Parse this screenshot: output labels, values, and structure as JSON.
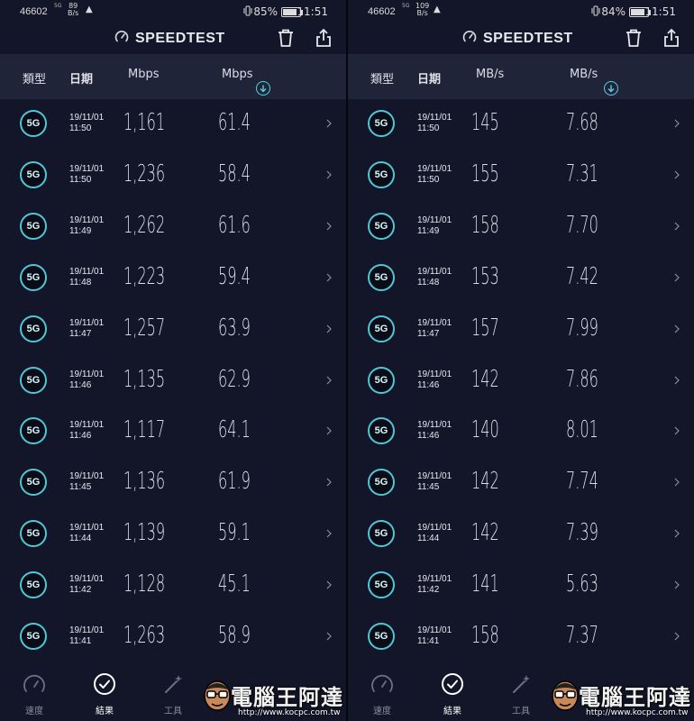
{
  "colors": {
    "background": "#131628",
    "header_bg": "#202439",
    "badge_ring": "#50c6d6",
    "download_accent": "#59cfe2",
    "upload_accent": "#c38de6"
  },
  "watermark": {
    "text": "電腦王阿達",
    "url": "http://www.kocpc.com.tw"
  },
  "screens": [
    {
      "status": {
        "carrier": "46602",
        "network": "5G",
        "net_speed_value": "89",
        "net_speed_unit": "B/s",
        "battery": "85%",
        "battery_level": 0.85,
        "time": "11:51"
      },
      "app_title": "SPEEDTEST",
      "headers": {
        "type": "類型",
        "date": "日期",
        "download_unit": "Mbps",
        "upload_unit": "Mbps"
      },
      "rows": [
        {
          "badge": "5G",
          "date": "19/11/01",
          "time": "11:50",
          "download": "1,161",
          "upload": "61.4"
        },
        {
          "badge": "5G",
          "date": "19/11/01",
          "time": "11:50",
          "download": "1,236",
          "upload": "58.4"
        },
        {
          "badge": "5G",
          "date": "19/11/01",
          "time": "11:49",
          "download": "1,262",
          "upload": "61.6"
        },
        {
          "badge": "5G",
          "date": "19/11/01",
          "time": "11:48",
          "download": "1,223",
          "upload": "59.4"
        },
        {
          "badge": "5G",
          "date": "19/11/01",
          "time": "11:47",
          "download": "1,257",
          "upload": "63.9"
        },
        {
          "badge": "5G",
          "date": "19/11/01",
          "time": "11:46",
          "download": "1,135",
          "upload": "62.9"
        },
        {
          "badge": "5G",
          "date": "19/11/01",
          "time": "11:46",
          "download": "1,117",
          "upload": "64.1"
        },
        {
          "badge": "5G",
          "date": "19/11/01",
          "time": "11:45",
          "download": "1,136",
          "upload": "61.9"
        },
        {
          "badge": "5G",
          "date": "19/11/01",
          "time": "11:44",
          "download": "1,139",
          "upload": "59.1"
        },
        {
          "badge": "5G",
          "date": "19/11/01",
          "time": "11:42",
          "download": "1,128",
          "upload": "45.1"
        },
        {
          "badge": "5G",
          "date": "19/11/01",
          "time": "11:41",
          "download": "1,263",
          "upload": "58.9"
        }
      ],
      "tabs": {
        "speed": "速度",
        "results": "結果",
        "tools": "工具"
      }
    },
    {
      "status": {
        "carrier": "46602",
        "network": "5G",
        "net_speed_value": "109",
        "net_speed_unit": "B/s",
        "battery": "84%",
        "battery_level": 0.84,
        "time": "11:51"
      },
      "app_title": "SPEEDTEST",
      "headers": {
        "type": "類型",
        "date": "日期",
        "download_unit": "MB/s",
        "upload_unit": "MB/s"
      },
      "rows": [
        {
          "badge": "5G",
          "date": "19/11/01",
          "time": "11:50",
          "download": "145",
          "upload": "7.68"
        },
        {
          "badge": "5G",
          "date": "19/11/01",
          "time": "11:50",
          "download": "155",
          "upload": "7.31"
        },
        {
          "badge": "5G",
          "date": "19/11/01",
          "time": "11:49",
          "download": "158",
          "upload": "7.70"
        },
        {
          "badge": "5G",
          "date": "19/11/01",
          "time": "11:48",
          "download": "153",
          "upload": "7.42"
        },
        {
          "badge": "5G",
          "date": "19/11/01",
          "time": "11:47",
          "download": "157",
          "upload": "7.99"
        },
        {
          "badge": "5G",
          "date": "19/11/01",
          "time": "11:46",
          "download": "142",
          "upload": "7.86"
        },
        {
          "badge": "5G",
          "date": "19/11/01",
          "time": "11:46",
          "download": "140",
          "upload": "8.01"
        },
        {
          "badge": "5G",
          "date": "19/11/01",
          "time": "11:45",
          "download": "142",
          "upload": "7.74"
        },
        {
          "badge": "5G",
          "date": "19/11/01",
          "time": "11:44",
          "download": "142",
          "upload": "7.39"
        },
        {
          "badge": "5G",
          "date": "19/11/01",
          "time": "11:42",
          "download": "141",
          "upload": "5.63"
        },
        {
          "badge": "5G",
          "date": "19/11/01",
          "time": "11:41",
          "download": "158",
          "upload": "7.37"
        }
      ],
      "tabs": {
        "speed": "速度",
        "results": "結果",
        "tools": "工具"
      }
    }
  ]
}
